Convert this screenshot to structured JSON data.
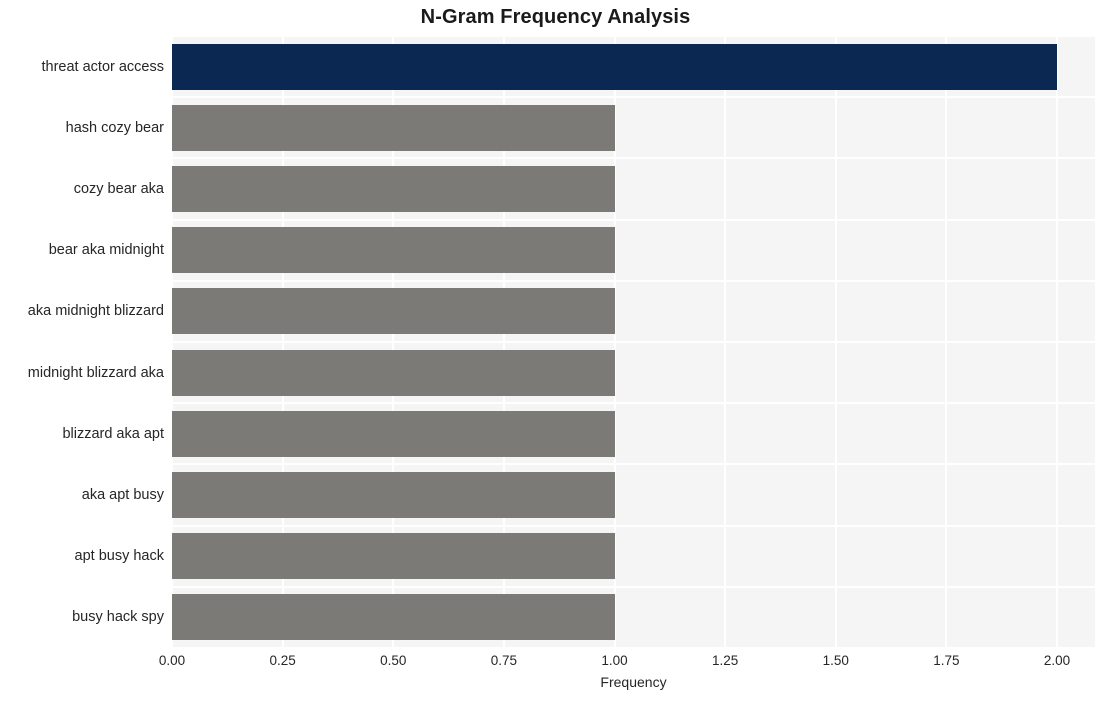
{
  "chart_data": {
    "type": "bar",
    "orientation": "horizontal",
    "title": "N-Gram Frequency Analysis",
    "xlabel": "Frequency",
    "ylabel": "",
    "categories": [
      "threat actor access",
      "hash cozy bear",
      "cozy bear aka",
      "bear aka midnight",
      "aka midnight blizzard",
      "midnight blizzard aka",
      "blizzard aka apt",
      "aka apt busy",
      "apt busy hack",
      "busy hack spy"
    ],
    "values": [
      2,
      1,
      1,
      1,
      1,
      1,
      1,
      1,
      1,
      1
    ],
    "xlim": [
      0,
      2
    ],
    "xticks": [
      "0.00",
      "0.25",
      "0.50",
      "0.75",
      "1.00",
      "1.25",
      "1.50",
      "1.75",
      "2.00"
    ],
    "xtick_values": [
      0,
      0.25,
      0.5,
      0.75,
      1,
      1.25,
      1.5,
      1.75,
      2
    ],
    "grid": true,
    "legend": false,
    "colors": {
      "highlight_bar": "#0a2851",
      "default_bar": "#7b7a76",
      "plot_background": "#f5f5f5",
      "gridline": "#ffffff",
      "figure_background": "#ffffff",
      "text": "#262626",
      "title_text": "#1a1a1a"
    },
    "bar_colors": [
      "#0a2851",
      "#7b7a76",
      "#7b7a76",
      "#7b7a76",
      "#7b7a76",
      "#7b7a76",
      "#7b7a76",
      "#7b7a76",
      "#7b7a76",
      "#7b7a76"
    ]
  }
}
